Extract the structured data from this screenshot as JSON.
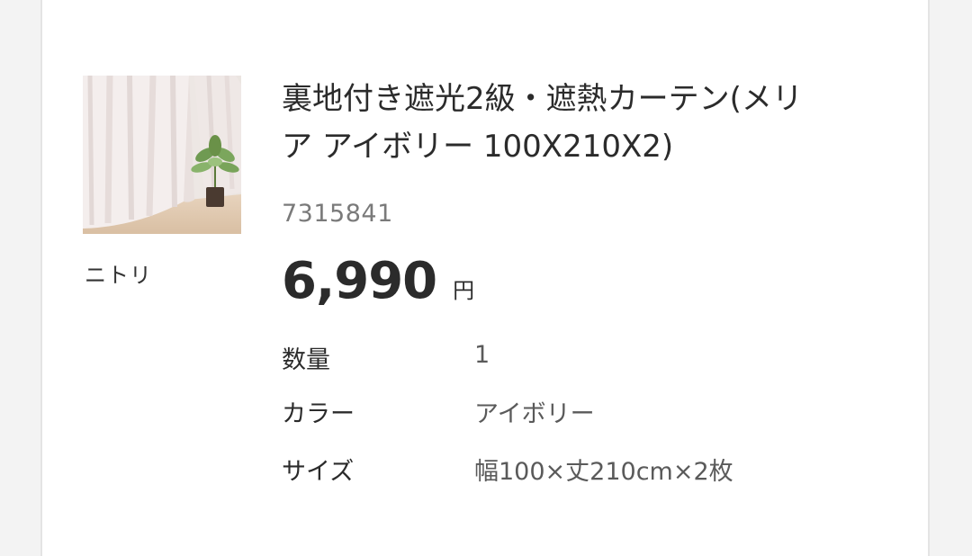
{
  "product": {
    "brand": "ニトリ",
    "title": "裏地付き遮光2級・遮熱カーテン(メリ\nア アイボリー 100X210X2)",
    "code": "7315841",
    "price": "6,990",
    "currency": "円"
  },
  "attributes": {
    "quantity_label": "数量",
    "quantity_value": "1",
    "color_label": "カラー",
    "color_value": "アイボリー",
    "size_label": "サイズ",
    "size_value": "幅100×丈210cm×2枚"
  },
  "colors": {
    "card_bg": "#ffffff",
    "page_bg": "#f3f3f3",
    "text": "#2b2b2b",
    "muted": "#7a7a7a"
  },
  "icons": {
    "thumbnail": "curtain-product-image"
  }
}
